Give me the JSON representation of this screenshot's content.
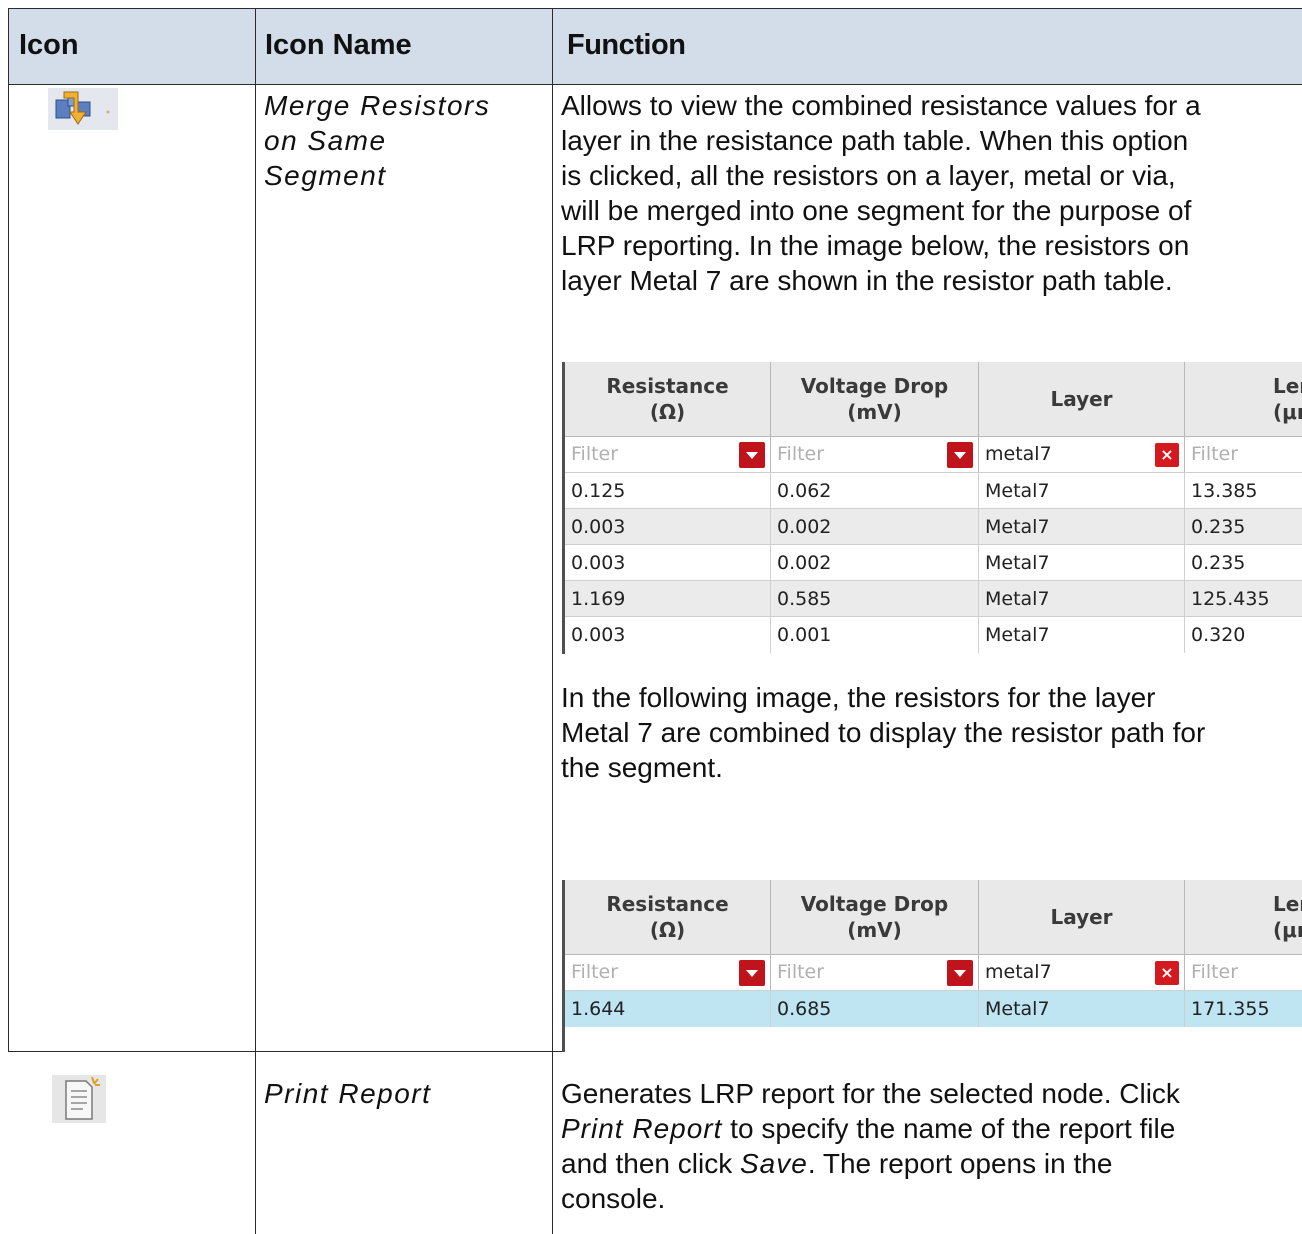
{
  "header": {
    "col_icon": "Icon",
    "col_name": "Icon Name",
    "col_function": "Function"
  },
  "rows": [
    {
      "icon": "merge-resistors-icon",
      "name_lines": [
        "Merge Resistors",
        "on Same",
        "Segment"
      ],
      "function_lines": [
        "Allows to view the combined resistance values for a",
        "layer in the resistance path table. When this option",
        "is clicked, all the resistors on a layer, metal or via,",
        "will be merged into one segment for the purpose of",
        "LRP reporting. In the image below, the resistors on",
        "layer Metal 7 are shown in the resistor path table."
      ],
      "function_after_lines": [
        "In the following image, the resistors for the layer",
        "Metal 7 are combined to display the resistor path for",
        "the segment."
      ]
    },
    {
      "icon": "print-report-icon",
      "name": "Print Report",
      "function": {
        "l1": "Generates LRP report for the selected node. Click",
        "l2_italic": "Print Report",
        "l2_rest": " to specify the name of the report file",
        "l3_pre": "and then click ",
        "l3_italic": "Save",
        "l3_rest": ". The report opens in the",
        "l4": "console."
      }
    }
  ],
  "resistor_table": {
    "columns": [
      {
        "line1": "Resistance",
        "line2": "(Ω)"
      },
      {
        "line1": "Voltage Drop",
        "line2": "(mV)"
      },
      {
        "line1": "Layer",
        "line2": ""
      },
      {
        "line1": "Leng",
        "line2": "(μm"
      }
    ],
    "filter_placeholder": "Filter",
    "filter_layer_value": "metal7",
    "clear_glyph": "×",
    "rows_before": [
      [
        "0.125",
        "0.062",
        "Metal7",
        "13.385"
      ],
      [
        "0.003",
        "0.002",
        "Metal7",
        "0.235"
      ],
      [
        "0.003",
        "0.002",
        "Metal7",
        "0.235"
      ],
      [
        "1.169",
        "0.585",
        "Metal7",
        "125.435"
      ],
      [
        "0.003",
        "0.001",
        "Metal7",
        "0.320"
      ]
    ],
    "rows_after": [
      [
        "1.644",
        "0.685",
        "Metal7",
        "171.355"
      ]
    ]
  },
  "colors": {
    "header_bg": "#d2dde9",
    "dropdown_red": "#c0141c",
    "selected_row": "#bfe4f2"
  }
}
